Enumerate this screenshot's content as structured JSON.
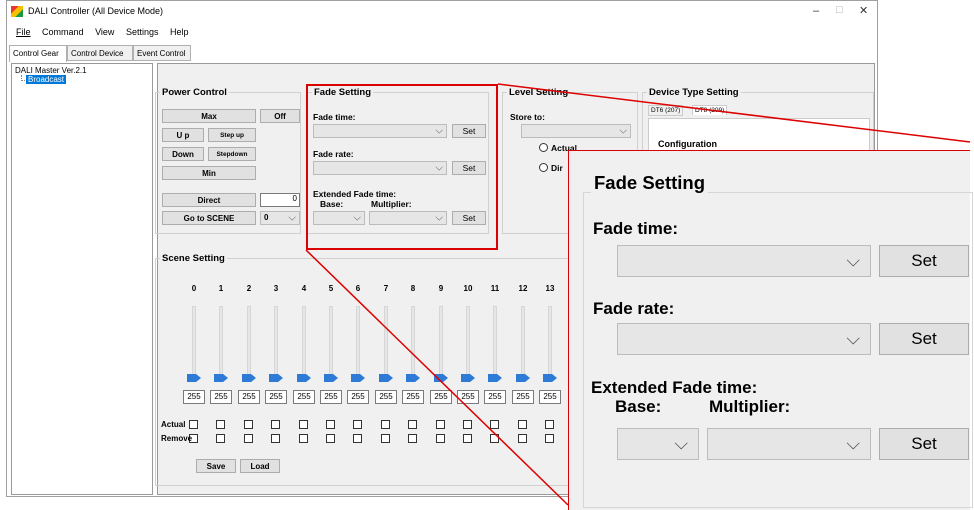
{
  "window": {
    "title": "DALI Controller (All Device Mode)",
    "minimize": "–",
    "maximize": "□",
    "close": "✕"
  },
  "menu": [
    "File",
    "Command",
    "View",
    "Settings",
    "Help"
  ],
  "tabs": [
    "Control Gear",
    "Control Device",
    "Event Control"
  ],
  "tree": {
    "root": "DALI Master Ver.2.1",
    "child": "Broadcast"
  },
  "power": {
    "title": "Power Control",
    "max": "Max",
    "off": "Off",
    "up": "U p",
    "step_up": "Step up",
    "down": "Down",
    "step_down": "Stepdown",
    "min": "Min",
    "direct": "Direct",
    "direct_value": "0",
    "go_scene": "Go to SCENE",
    "scene_value": "0"
  },
  "fade": {
    "title": "Fade Setting",
    "fade_time": "Fade time:",
    "fade_rate": "Fade rate:",
    "extended": "Extended Fade time:",
    "base": "Base:",
    "multiplier": "Multiplier:",
    "set": "Set"
  },
  "level": {
    "title": "Level Setting",
    "store_to": "Store to:",
    "actual": "Actual",
    "direct": "Dir"
  },
  "device": {
    "title": "Device Type Setting",
    "tab1": "DT6 (207)",
    "tab2": "DT8 (209)",
    "configuration": "Configuration"
  },
  "scene": {
    "title": "Scene Setting",
    "numbers": [
      "0",
      "1",
      "2",
      "3",
      "4",
      "5",
      "6",
      "7",
      "8",
      "9",
      "10",
      "11",
      "12",
      "13"
    ],
    "values": [
      "255",
      "255",
      "255",
      "255",
      "255",
      "255",
      "255",
      "255",
      "255",
      "255",
      "255",
      "255",
      "255",
      "255"
    ],
    "actual": "Actual",
    "remove": "Remove",
    "save": "Save",
    "load": "Load"
  },
  "colors": {
    "accent": "#2d7bd6",
    "highlight": "#d00000"
  }
}
